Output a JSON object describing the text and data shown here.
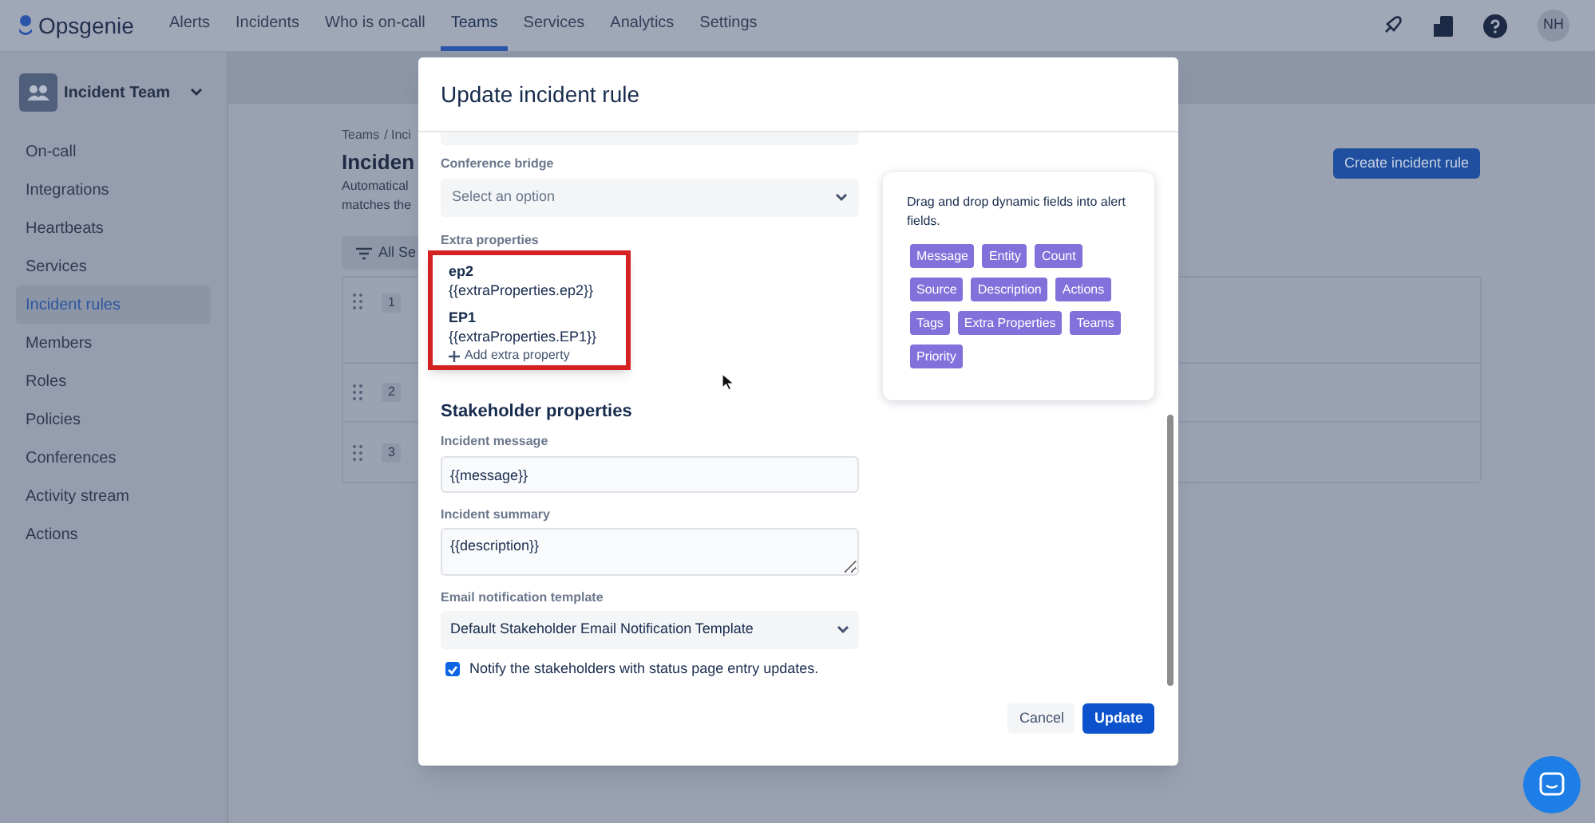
{
  "nav": {
    "logo": "Opsgenie",
    "items": [
      {
        "label": "Alerts",
        "selected": false
      },
      {
        "label": "Incidents",
        "selected": false
      },
      {
        "label": "Who is on-call",
        "selected": false
      },
      {
        "label": "Teams",
        "selected": true
      },
      {
        "label": "Services",
        "selected": false
      },
      {
        "label": "Analytics",
        "selected": false
      },
      {
        "label": "Settings",
        "selected": false
      }
    ],
    "avatar": "NH"
  },
  "sidebar": {
    "team": "Incident Team",
    "items": [
      {
        "label": "On-call",
        "selected": false
      },
      {
        "label": "Integrations",
        "selected": false
      },
      {
        "label": "Heartbeats",
        "selected": false
      },
      {
        "label": "Services",
        "selected": false
      },
      {
        "label": "Incident rules",
        "selected": true
      },
      {
        "label": "Members",
        "selected": false
      },
      {
        "label": "Roles",
        "selected": false
      },
      {
        "label": "Policies",
        "selected": false
      },
      {
        "label": "Conferences",
        "selected": false
      },
      {
        "label": "Activity stream",
        "selected": false
      },
      {
        "label": "Actions",
        "selected": false
      }
    ]
  },
  "page": {
    "breadcrumb": [
      "Teams",
      "/ Inci"
    ],
    "title": "Inciden",
    "description": [
      "Automatical",
      "matches the"
    ],
    "create_button": "Create incident rule",
    "filter": "All Se",
    "rows": [
      "1",
      "2",
      "3"
    ]
  },
  "modal": {
    "title": "Update incident rule",
    "conference_bridge": {
      "label": "Conference bridge",
      "placeholder": "Select an option"
    },
    "extra_properties": {
      "label": "Extra properties",
      "items": [
        {
          "name": "ep2",
          "value": "{{extraProperties.ep2}}"
        },
        {
          "name": "EP1",
          "value": "{{extraProperties.EP1}}"
        }
      ],
      "add": "Add extra property"
    },
    "help": {
      "text": "Drag and drop dynamic fields into alert fields.",
      "fields": [
        "Message",
        "Entity",
        "Count",
        "Source",
        "Description",
        "Actions",
        "Tags",
        "Extra Properties",
        "Teams",
        "Priority"
      ]
    },
    "stakeholder": {
      "heading": "Stakeholder properties",
      "message": {
        "label": "Incident message",
        "value": "{{message}}"
      },
      "summary": {
        "label": "Incident summary",
        "value": "{{description}}"
      },
      "template": {
        "label": "Email notification template",
        "value": "Default Stakeholder Email Notification Template"
      },
      "notify": {
        "label": "Notify the stakeholders with status page entry updates.",
        "checked": true
      }
    },
    "buttons": {
      "cancel": "Cancel",
      "update": "Update"
    }
  }
}
